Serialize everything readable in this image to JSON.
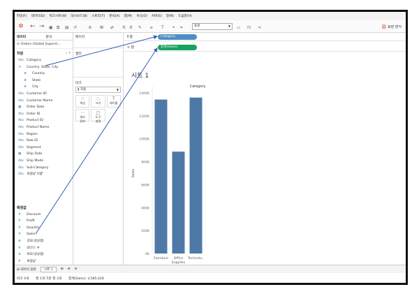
{
  "menu": [
    "파일(F)",
    "데이터(D)",
    "워크시트(W)",
    "대시보드(B)",
    "스토리(T)",
    "분석(A)",
    "맵(M)",
    "서식(O)",
    "서버(S)",
    "창(N)",
    "도움말(H)"
  ],
  "toolbar": {
    "mark_label_dropdown": "표준",
    "show_me": "표현 방식"
  },
  "left_pane": {
    "tabs": [
      "데이터",
      "분석"
    ],
    "data_source": "Orders (Global Superst...",
    "dimensions_header": "차원",
    "dimensions": [
      {
        "label": "Category",
        "icon": "Abc",
        "indent": false
      },
      {
        "label": "Country, State, City",
        "icon": "hierarchy",
        "indent": false
      },
      {
        "label": "Country",
        "icon": "globe",
        "indent": true
      },
      {
        "label": "State",
        "icon": "globe",
        "indent": true
      },
      {
        "label": "City",
        "icon": "globe",
        "indent": true
      },
      {
        "label": "Customer ID",
        "icon": "Abc",
        "indent": false
      },
      {
        "label": "Customer Name",
        "icon": "Abc",
        "indent": false
      },
      {
        "label": "Order Date",
        "icon": "date",
        "indent": false
      },
      {
        "label": "Order ID",
        "icon": "Abc",
        "indent": false
      },
      {
        "label": "Product ID",
        "icon": "Abc",
        "indent": false
      },
      {
        "label": "Product Name",
        "icon": "Abc",
        "indent": false
      },
      {
        "label": "Region",
        "icon": "Abc",
        "indent": false
      },
      {
        "label": "Row ID",
        "icon": "Abc",
        "indent": false
      },
      {
        "label": "Segment",
        "icon": "Abc",
        "indent": false
      },
      {
        "label": "Ship Date",
        "icon": "date",
        "indent": false
      },
      {
        "label": "Ship Mode",
        "icon": "Abc",
        "indent": false
      },
      {
        "label": "Sub-Category",
        "icon": "Abc",
        "indent": false
      },
      {
        "label": "측정값 이름",
        "icon": "Abc",
        "indent": false,
        "italic": true
      }
    ],
    "measures_header": "측정값",
    "measures": [
      {
        "label": "Discount",
        "icon": "#"
      },
      {
        "label": "Profit",
        "icon": "#"
      },
      {
        "label": "Quantity",
        "icon": "#"
      },
      {
        "label": "Sales",
        "icon": "#"
      },
      {
        "label": "경도(생성됨)",
        "icon": "globe",
        "italic": true
      },
      {
        "label": "레코드 수",
        "icon": "#",
        "italic": true
      },
      {
        "label": "위도(생성됨)",
        "icon": "globe",
        "italic": true
      },
      {
        "label": "측정값",
        "icon": "#",
        "italic": true
      }
    ]
  },
  "mid_pane": {
    "pages_label": "페이지",
    "filters_label": "필터",
    "marks_label": "마크",
    "mark_type": "자동",
    "marks_buttons": [
      {
        "glyph": "⁙",
        "label": "색상"
      },
      {
        "glyph": "◌",
        "label": "크기"
      },
      {
        "glyph": "T",
        "label": "레이블"
      },
      {
        "glyph": "⋯",
        "label": "세부\n정보"
      },
      {
        "glyph": "▢",
        "label": "도구\n설명"
      }
    ]
  },
  "shelves": {
    "columns_label": "열",
    "rows_label": "행",
    "columns_pill": "Category",
    "rows_pill": "합계(Sales)"
  },
  "view": {
    "sheet_title": "시트 1"
  },
  "chart_data": {
    "type": "bar",
    "title": "Category",
    "categories": [
      "Furniture",
      "Office Supplies",
      "Technology"
    ],
    "category_labels": [
      "Furniture",
      "Office\nSupplies",
      "Technolo.."
    ],
    "values": [
      1342000,
      888000,
      1359000
    ],
    "ylabel": "Sales",
    "ylim": [
      0,
      1400000
    ],
    "yticks": [
      0,
      200000,
      400000,
      600000,
      800000,
      1000000,
      1200000,
      1400000
    ],
    "ytick_labels": [
      "0K",
      "200K",
      "400K",
      "600K",
      "800K",
      "1000K",
      "1200K",
      "1400K"
    ],
    "bar_color": "#4e79a7"
  },
  "bottom": {
    "data_source_tab": "데이터 원본",
    "sheet_tab": "시트 1"
  },
  "status": {
    "marks": "마크 3개",
    "rows_cols": "행 1개 기준 열 3개",
    "sum": "합계(Sales): 3,585,428"
  },
  "colors": {
    "columns_pill": "#4f8ec4",
    "rows_pill": "#19a25d",
    "annotation_arrow": "#2f5fb8"
  }
}
